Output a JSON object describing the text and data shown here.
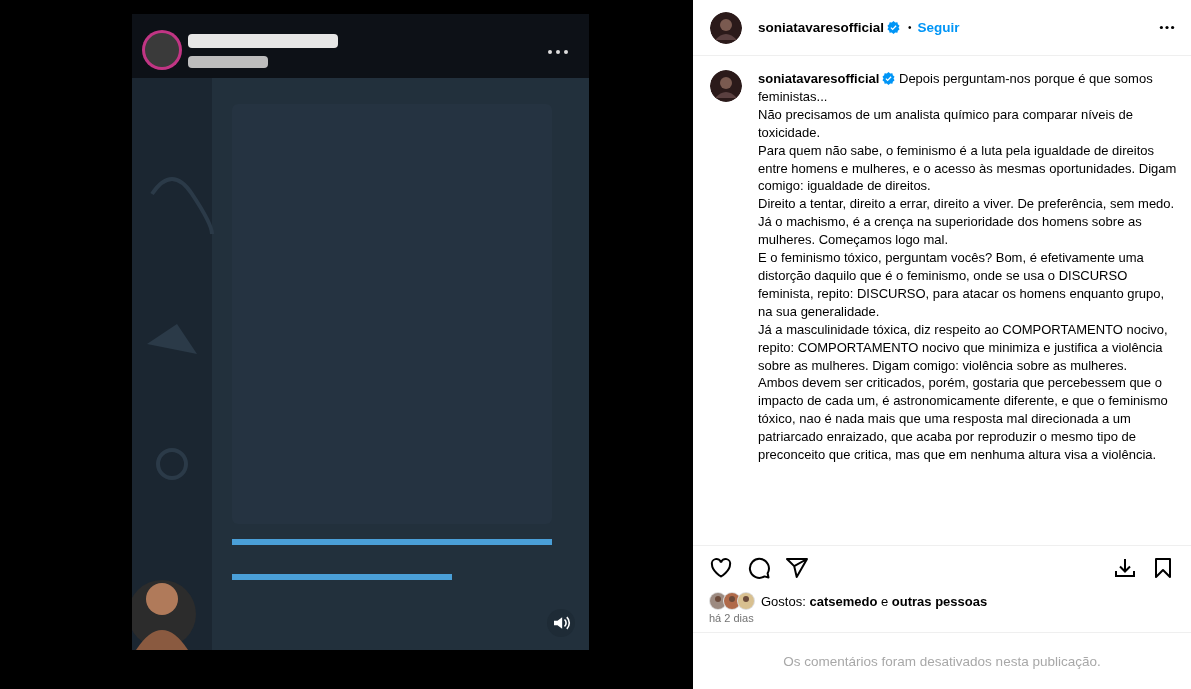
{
  "header": {
    "username": "soniatavaresofficial",
    "verified": true,
    "separator": "•",
    "follow": "Seguir"
  },
  "caption": {
    "username": "soniatavaresofficial",
    "verified": true,
    "paragraphs": [
      "Depois perguntam-nos porque é que somos feministas...",
      "Não precisamos de um analista químico para comparar níveis de toxicidade.",
      "Para quem não sabe, o feminismo é a luta pela igualdade de direitos entre homens e mulheres, e o acesso às mesmas oportunidades. Digam comigo: igualdade de direitos.",
      "Direito a tentar, direito a errar, direito a viver. De preferência, sem medo.",
      "Já o machismo, é a crença na superioridade dos homens sobre as mulheres. Começamos logo mal.",
      "E o feminismo tóxico, perguntam vocês? Bom, é efetivamente uma distorção daquilo que é o feminismo, onde se usa o DISCURSO feminista, repito: DISCURSO, para atacar os homens enquanto grupo, na sua generalidade.",
      "Já a masculinidade tóxica, diz respeito ao COMPORTAMENTO nocivo, repito: COMPORTAMENTO nocivo que minimiza e justifica a violência sobre as mulheres. Digam comigo: violência sobre as mulheres.",
      "Ambos devem ser criticados, porém, gostaria que percebessem que o impacto de cada um, é astronomicamente diferente, e que o feminismo tóxico, nao é nada mais que uma resposta mal direcionada a um patriarcado enraizado, que acaba por reproduzir o mesmo tipo de preconceito que critica, mas que em nenhuma altura visa a violência."
    ]
  },
  "likes": "Gostos: **catsemedo** e **outras pessoas**",
  "date": "há 2 dias",
  "comments_notice": "Os comentários foram desativados nesta publicação."
}
